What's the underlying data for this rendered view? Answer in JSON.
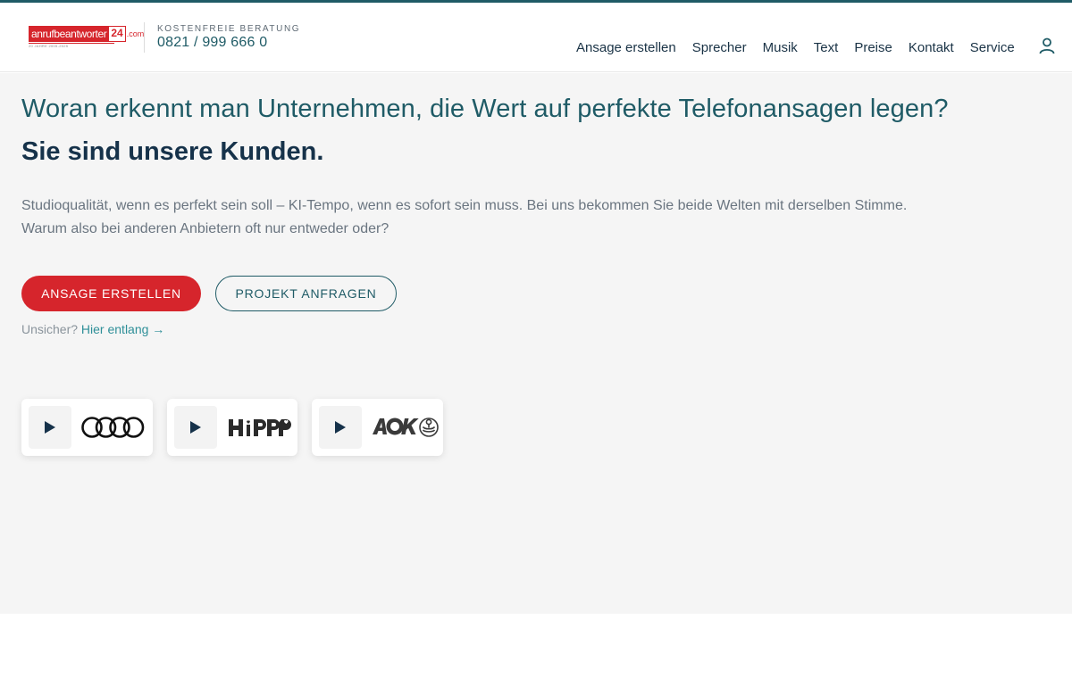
{
  "header": {
    "logo": {
      "word": "anrufbeantworter",
      "number": "24",
      "domain": ".com",
      "tagline": "20 JAHRE 2005-2025"
    },
    "consult_label": "KOSTENFREIE BERATUNG",
    "phone": "0821 / 999 666 0",
    "nav": [
      {
        "label": "Ansage erstellen"
      },
      {
        "label": "Sprecher"
      },
      {
        "label": "Musik"
      },
      {
        "label": "Text"
      },
      {
        "label": "Preise"
      },
      {
        "label": "Kontakt"
      },
      {
        "label": "Service"
      }
    ],
    "account_icon": "user-icon"
  },
  "hero": {
    "question": "Woran erkennt man Unternehmen, die Wert auf perfekte Telefonansagen legen?",
    "answer": "Sie sind unsere Kunden.",
    "lead_line1": "Studioqualität, wenn es perfekt sein soll – KI-Tempo, wenn es sofort sein muss. Bei uns bekommen Sie beide Welten mit derselben Stimme.",
    "lead_line2": "Warum also bei anderen Anbietern oft nur entweder oder?",
    "primary_button": "Ansage erstellen",
    "secondary_button": "Projekt anfragen",
    "unsure_text": "Unsicher?",
    "unsure_link": "Hier entlang →"
  },
  "references": [
    {
      "brand": "audi-logo",
      "icon": "play-icon"
    },
    {
      "brand": "hipp-logo",
      "icon": "play-icon"
    },
    {
      "brand": "aok-logo",
      "icon": "play-icon"
    }
  ],
  "colors": {
    "brand_red": "#d6252c",
    "teal": "#1f5b66",
    "navy": "#16324a",
    "hero_bg": "#f5f5f5"
  }
}
